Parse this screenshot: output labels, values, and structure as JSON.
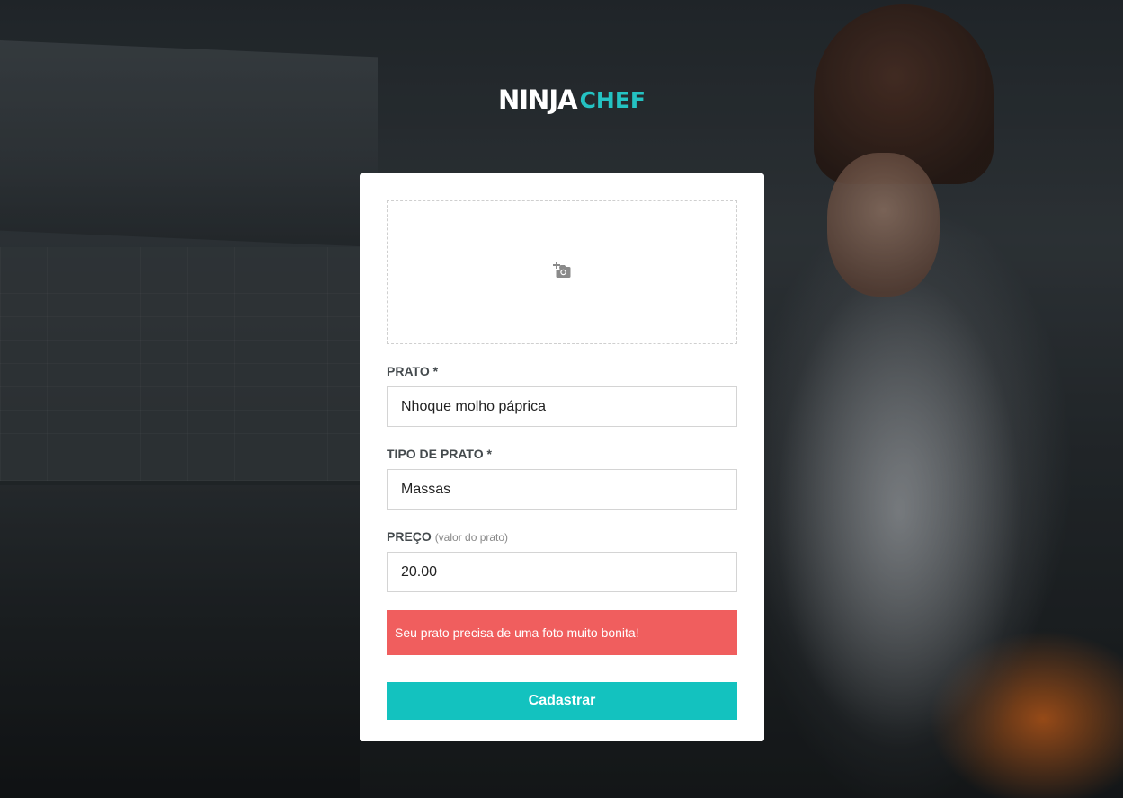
{
  "brand": {
    "name_part1": "NINJA",
    "name_part2": "CHEF",
    "accent_color": "#13c2bf"
  },
  "form": {
    "photo_upload": {
      "icon": "add-photo-icon"
    },
    "fields": [
      {
        "label": "PRATO *",
        "hint": "",
        "value": "Nhoque molho páprica"
      },
      {
        "label": "TIPO DE PRATO *",
        "hint": "",
        "value": "Massas"
      },
      {
        "label": "PREÇO",
        "hint": "(valor do prato)",
        "value": "20.00"
      }
    ],
    "alert": {
      "text": "Seu prato precisa de uma foto muito bonita!",
      "color": "#f05e5e"
    },
    "submit_label": "Cadastrar"
  }
}
